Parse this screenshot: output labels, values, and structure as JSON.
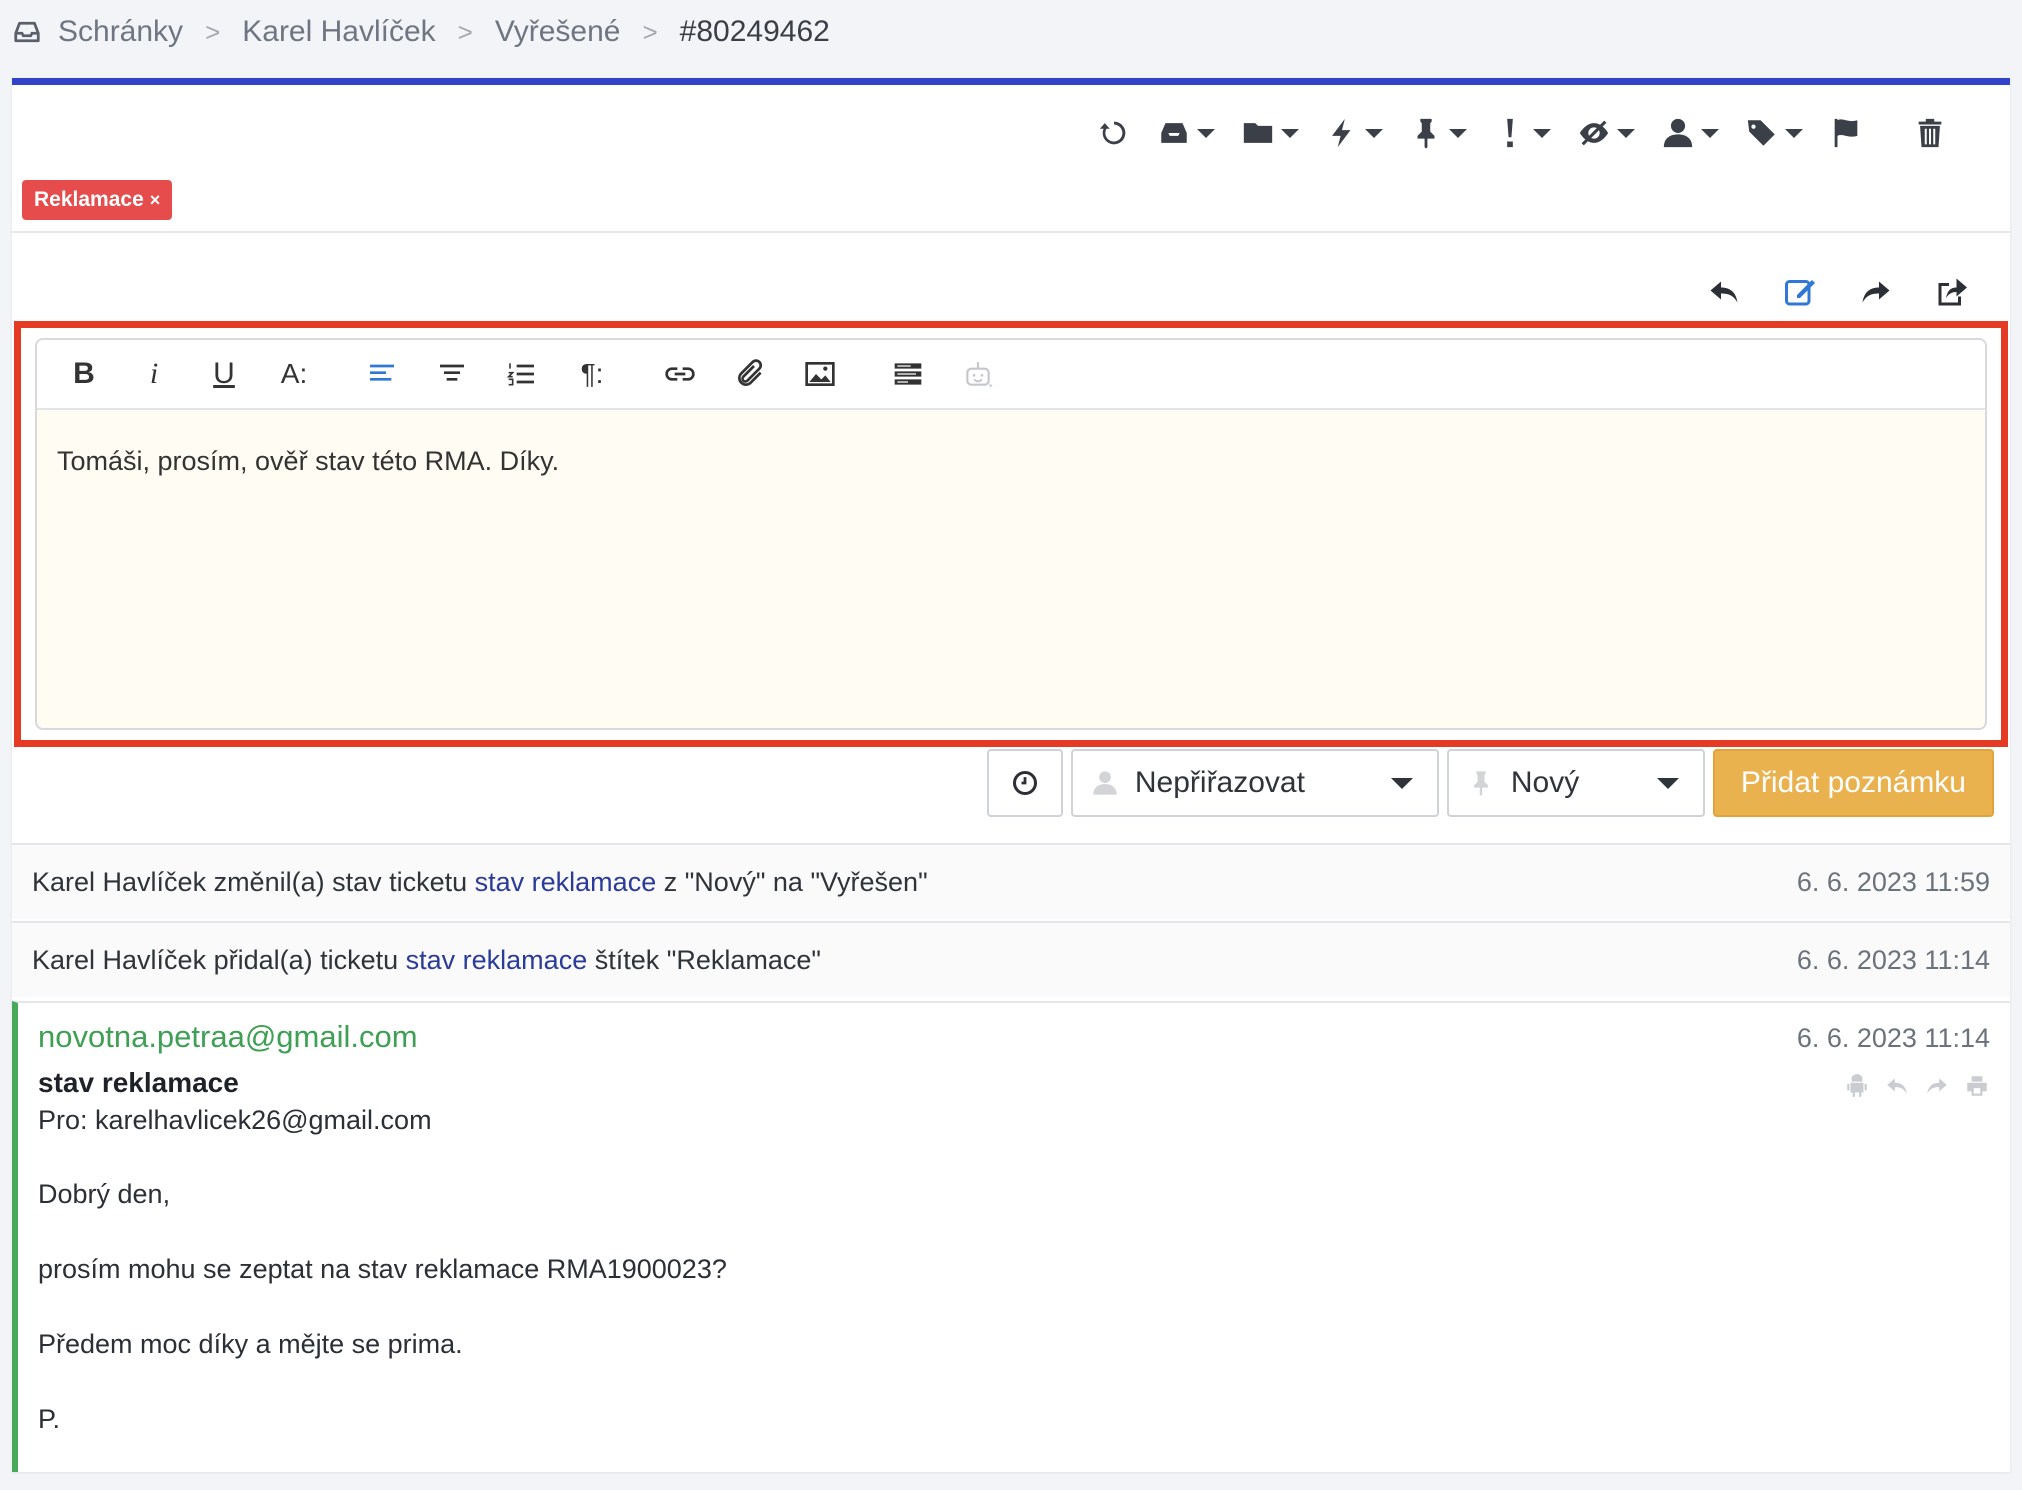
{
  "breadcrumb": {
    "items": [
      "Schránky",
      "Karel Havlíček",
      "Vyřešené"
    ],
    "separator": ">",
    "current": "#80249462"
  },
  "toolbar": {
    "icons": [
      "refresh-icon",
      "inbox-icon",
      "folder-icon",
      "bolt-icon",
      "pin-icon",
      "priority-icon",
      "visibility-icon",
      "user-icon",
      "tags-icon",
      "flag-icon",
      "trash-icon"
    ]
  },
  "tag": {
    "label": "Reklamace",
    "remove": "×",
    "color": "#e74c4c"
  },
  "reply_actions": [
    "reply-icon",
    "note-icon",
    "forward-icon",
    "share-icon"
  ],
  "editor": {
    "buttons": [
      "bold",
      "italic",
      "underline",
      "font-size",
      "align-left",
      "align-center",
      "ordered-list",
      "paragraph",
      "link",
      "attachment",
      "image",
      "template",
      "ai-assistant"
    ],
    "bold_label": "B",
    "italic_label": "i",
    "underline_label": "U",
    "fontsize_label": "A:",
    "paragraph_label": "¶:",
    "content": "Tomáši, prosím, ověř stav této RMA. Díky."
  },
  "actions": {
    "assign": "Nepřiřazovat",
    "status": "Nový",
    "submit": "Přidat poznámku",
    "submit_color": "#e9b24f"
  },
  "history": [
    {
      "prefix": "Karel Havlíček změnil(a) stav ticketu ",
      "link": "stav reklamace",
      "suffix": " z \"Nový\" na \"Vyřešen\"",
      "date": "6. 6. 2023 11:59"
    },
    {
      "prefix": "Karel Havlíček přidal(a) ticketu ",
      "link": "stav reklamace",
      "suffix": " štítek \"Reklamace\"",
      "date": "6. 6. 2023 11:14"
    }
  ],
  "message": {
    "from": "novotna.petraa@gmail.com",
    "date": "6. 6. 2023 11:14",
    "subject": "stav reklamace",
    "to": "Pro: karelhavlicek26@gmail.com",
    "body": [
      "Dobrý den,",
      "prosím mohu se zeptat na stav reklamace RMA1900023?",
      "Předem moc díky a mějte se prima.",
      "P."
    ],
    "accent": "#48a95a"
  },
  "colors": {
    "card_top": "#3344cc",
    "highlight": "#e53a23",
    "link": "#2b3b9a"
  }
}
